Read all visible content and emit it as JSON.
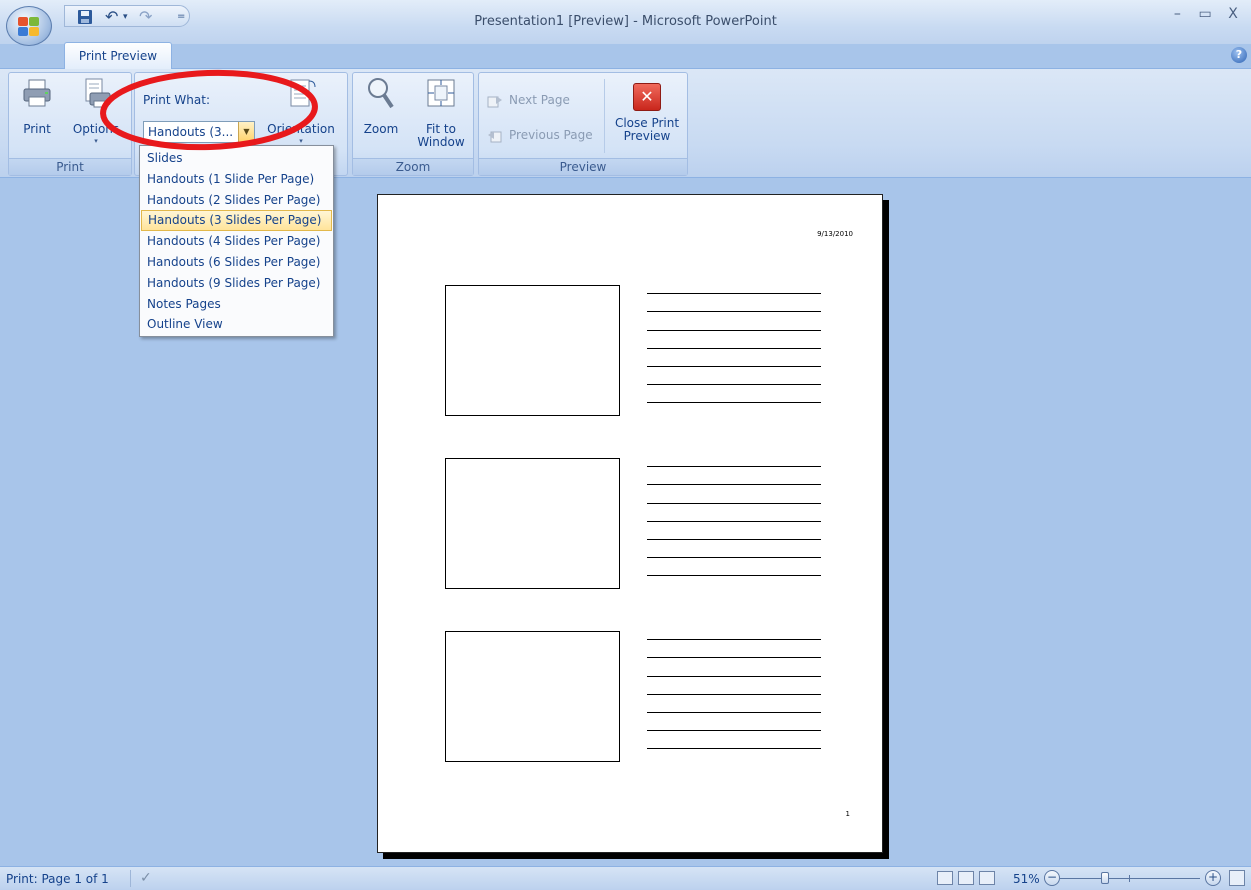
{
  "window": {
    "title": "Presentation1 [Preview] - Microsoft PowerPoint",
    "controls": [
      "–",
      "▭",
      "X"
    ]
  },
  "quick_access": {
    "icons": [
      "save-icon",
      "undo-icon",
      "redo-icon",
      "customize-icon"
    ],
    "undo_glyph": "↶",
    "redo_glyph": "↷",
    "dropdown_glyph": "▾",
    "customize_glyph": "="
  },
  "tabs": {
    "active": "Print Preview",
    "help_glyph": "?"
  },
  "ribbon": {
    "print_group": {
      "label": "Print",
      "print_button": "Print",
      "options_button": "Options",
      "dropdown_glyph": "▾"
    },
    "page_setup": {
      "print_what_label": "Print What:",
      "print_what_value": "Handouts (3...",
      "orientation_button": "Orientation",
      "options": [
        "Slides",
        "Handouts (1 Slide Per Page)",
        "Handouts (2 Slides Per Page)",
        "Handouts (3 Slides Per Page)",
        "Handouts (4 Slides Per Page)",
        "Handouts (6 Slides Per Page)",
        "Handouts (9 Slides Per Page)",
        "Notes Pages",
        "Outline View"
      ],
      "selected_option": "Handouts (3 Slides Per Page)"
    },
    "zoom_group": {
      "label": "Zoom",
      "zoom_button": "Zoom",
      "fit_line1": "Fit to",
      "fit_line2": "Window"
    },
    "preview_group": {
      "label": "Preview",
      "next_page": "Next Page",
      "previous_page": "Previous Page",
      "close_line1": "Close Print",
      "close_line2": "Preview",
      "close_glyph": "✕"
    }
  },
  "page": {
    "date": "9/13/2010",
    "number": "1",
    "slides_per_page": 3,
    "note_lines_per_slide": 7
  },
  "status": {
    "text": "Print: Page 1 of 1",
    "zoom": "51%",
    "zoom_out_glyph": "−",
    "zoom_in_glyph": "+",
    "spell_glyph": "✓"
  },
  "colors": {
    "annotation": "#e8191c",
    "workspace": "#a8c5ea",
    "ribbon_text": "#15428b",
    "selected_item": "#ffe49a"
  }
}
